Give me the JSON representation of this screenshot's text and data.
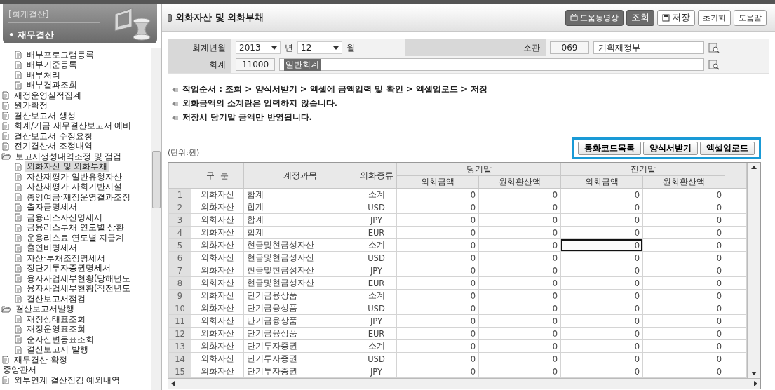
{
  "sidebar": {
    "section": "[회계결산]",
    "title": "• 재무결산",
    "tree": [
      {
        "children": [
          {
            "children": [
              {
                "label": "배부프로그램등록",
                "kind": "doc",
                "selected": false
              },
              {
                "label": "배부기준등록",
                "kind": "doc",
                "selected": false
              },
              {
                "label": "배부처리",
                "kind": "doc",
                "selected": false
              },
              {
                "label": "배부결과조회",
                "kind": "doc",
                "selected": false
              }
            ]
          },
          {
            "label": "재정운영실적집계",
            "kind": "doc",
            "selected": false
          },
          {
            "label": "원가확정",
            "kind": "doc",
            "selected": false
          }
        ]
      },
      {
        "label": "결산보고서 생성",
        "kind": "doc",
        "selected": false
      },
      {
        "label": "회계/기금 재무결산보고서 예비",
        "kind": "doc",
        "selected": false
      },
      {
        "label": "결산보고서 수정요청",
        "kind": "doc",
        "selected": false
      },
      {
        "label": "전기결산서 조정내역",
        "kind": "doc",
        "selected": false
      },
      {
        "label": "보고서생성내역조정 및 점검",
        "kind": "folder",
        "expanded": true,
        "selected": false,
        "children": [
          {
            "label": "외화자산 및 외화부채",
            "kind": "doc",
            "selected": true
          },
          {
            "label": "자산재평가-일반유형자산",
            "kind": "doc",
            "selected": false
          },
          {
            "label": "자산재평가-사회기반시설",
            "kind": "doc",
            "selected": false
          },
          {
            "label": "총잉여금·재정운영결과조정",
            "kind": "doc",
            "selected": false
          },
          {
            "label": "출자금명세서",
            "kind": "doc",
            "selected": false
          },
          {
            "label": "금융리스자산명세서",
            "kind": "doc",
            "selected": false
          },
          {
            "label": "금융리스부채 연도별 상환",
            "kind": "doc",
            "selected": false
          },
          {
            "label": "운용리스료 연도별 지급계",
            "kind": "doc",
            "selected": false
          },
          {
            "label": "출연비명세서",
            "kind": "doc",
            "selected": false
          },
          {
            "label": "자산·부채조정명세서",
            "kind": "doc",
            "selected": false
          },
          {
            "label": "장단기투자증권명세서",
            "kind": "doc",
            "selected": false
          },
          {
            "label": "융자사업세부현황(당해년도",
            "kind": "doc",
            "selected": false
          },
          {
            "label": "융자사업세부현황(직전년도",
            "kind": "doc",
            "selected": false
          },
          {
            "label": "결산보고서점검",
            "kind": "doc",
            "selected": false
          }
        ]
      },
      {
        "label": "결산보고서발행",
        "kind": "folder",
        "expanded": true,
        "selected": false,
        "children": [
          {
            "label": "재정상태표조회",
            "kind": "doc",
            "selected": false
          },
          {
            "label": "재정운영표조회",
            "kind": "doc",
            "selected": false
          },
          {
            "label": "순자산변동표조회",
            "kind": "doc",
            "selected": false
          },
          {
            "label": "결산보고서 발행",
            "kind": "doc",
            "selected": false
          }
        ]
      },
      {
        "label": "재무결산 확정",
        "kind": "doc",
        "selected": false
      },
      {
        "label": "중앙관서",
        "kind": "text",
        "selected": false
      },
      {
        "label": "외부연계 결산점검 예외내역",
        "kind": "doc",
        "selected": false
      }
    ]
  },
  "page": {
    "title": "외화자산 및 외화부채",
    "toolbar": [
      {
        "label": "도움동영상",
        "kind": "video"
      },
      {
        "label": "조회",
        "kind": "primary"
      },
      {
        "label": "저장",
        "kind": "save"
      },
      {
        "label": "초기화",
        "kind": "plain"
      },
      {
        "label": "도움말",
        "kind": "plain"
      }
    ]
  },
  "form": {
    "period_label": "회계년월",
    "year": "2013",
    "year_unit": "년",
    "month": "12",
    "month_unit": "월",
    "ministry_label": "소관",
    "ministry_code": "069",
    "ministry_name": "기획재정부",
    "account_label": "회계",
    "account_code": "11000",
    "account_name": "일반회계",
    "account_name_selected": true
  },
  "notes": [
    "작업순서 : 조회 > 양식서받기 > 엑셀에 금액입력 및 확인 > 엑셀업로드 > 저장",
    "외화금액의 소계란은 입력하지 않습니다.",
    "저장시 당기말 금액만 반영됩니다."
  ],
  "unit": "(단위:원)",
  "actions": [
    "통화코드목록",
    "양식서받기",
    "엑셀업로드"
  ],
  "table": {
    "columns": {
      "category": "구  분",
      "account": "계정과목",
      "currency": "외화종류",
      "groups": [
        {
          "label": "당기말",
          "sub": [
            "외화금액",
            "원화환산액"
          ]
        },
        {
          "label": "전기말",
          "sub": [
            "외화금액",
            "원화환산액"
          ]
        }
      ]
    },
    "rows": [
      {
        "no": "1",
        "category": "외화자산",
        "account": "합계",
        "currency": "소계",
        "amounts": [
          {
            "value": "0",
            "focused": false
          },
          {
            "value": "0",
            "focused": false
          },
          {
            "value": "0",
            "focused": false
          },
          {
            "value": "0",
            "focused": false
          }
        ]
      },
      {
        "no": "2",
        "category": "외화자산",
        "account": "합계",
        "currency": "USD",
        "amounts": [
          {
            "value": "0",
            "focused": false
          },
          {
            "value": "0",
            "focused": false
          },
          {
            "value": "0",
            "focused": false
          },
          {
            "value": "0",
            "focused": false
          }
        ]
      },
      {
        "no": "3",
        "category": "외화자산",
        "account": "합계",
        "currency": "JPY",
        "amounts": [
          {
            "value": "0",
            "focused": false
          },
          {
            "value": "0",
            "focused": false
          },
          {
            "value": "0",
            "focused": false
          },
          {
            "value": "0",
            "focused": false
          }
        ]
      },
      {
        "no": "4",
        "category": "외화자산",
        "account": "합계",
        "currency": "EUR",
        "amounts": [
          {
            "value": "0",
            "focused": false
          },
          {
            "value": "0",
            "focused": false
          },
          {
            "value": "0",
            "focused": false
          },
          {
            "value": "0",
            "focused": false
          }
        ]
      },
      {
        "no": "5",
        "category": "외화자산",
        "account": "현금및현금성자산",
        "currency": "소계",
        "amounts": [
          {
            "value": "0",
            "focused": false
          },
          {
            "value": "0",
            "focused": false
          },
          {
            "value": "0",
            "focused": true
          },
          {
            "value": "0",
            "focused": false
          }
        ]
      },
      {
        "no": "6",
        "category": "외화자산",
        "account": "현금및현금성자산",
        "currency": "USD",
        "amounts": [
          {
            "value": "0",
            "focused": false
          },
          {
            "value": "0",
            "focused": false
          },
          {
            "value": "0",
            "focused": false
          },
          {
            "value": "0",
            "focused": false
          }
        ]
      },
      {
        "no": "7",
        "category": "외화자산",
        "account": "현금및현금성자산",
        "currency": "JPY",
        "amounts": [
          {
            "value": "0",
            "focused": false
          },
          {
            "value": "0",
            "focused": false
          },
          {
            "value": "0",
            "focused": false
          },
          {
            "value": "0",
            "focused": false
          }
        ]
      },
      {
        "no": "8",
        "category": "외화자산",
        "account": "현금및현금성자산",
        "currency": "EUR",
        "amounts": [
          {
            "value": "0",
            "focused": false
          },
          {
            "value": "0",
            "focused": false
          },
          {
            "value": "0",
            "focused": false
          },
          {
            "value": "0",
            "focused": false
          }
        ]
      },
      {
        "no": "9",
        "category": "외화자산",
        "account": "단기금융상품",
        "currency": "소계",
        "amounts": [
          {
            "value": "0",
            "focused": false
          },
          {
            "value": "0",
            "focused": false
          },
          {
            "value": "0",
            "focused": false
          },
          {
            "value": "0",
            "focused": false
          }
        ]
      },
      {
        "no": "10",
        "category": "외화자산",
        "account": "단기금융상품",
        "currency": "USD",
        "amounts": [
          {
            "value": "0",
            "focused": false
          },
          {
            "value": "0",
            "focused": false
          },
          {
            "value": "0",
            "focused": false
          },
          {
            "value": "0",
            "focused": false
          }
        ]
      },
      {
        "no": "11",
        "category": "외화자산",
        "account": "단기금융상품",
        "currency": "JPY",
        "amounts": [
          {
            "value": "0",
            "focused": false
          },
          {
            "value": "0",
            "focused": false
          },
          {
            "value": "0",
            "focused": false
          },
          {
            "value": "0",
            "focused": false
          }
        ]
      },
      {
        "no": "12",
        "category": "외화자산",
        "account": "단기금융상품",
        "currency": "EUR",
        "amounts": [
          {
            "value": "0",
            "focused": false
          },
          {
            "value": "0",
            "focused": false
          },
          {
            "value": "0",
            "focused": false
          },
          {
            "value": "0",
            "focused": false
          }
        ]
      },
      {
        "no": "13",
        "category": "외화자산",
        "account": "단기투자증권",
        "currency": "소계",
        "amounts": [
          {
            "value": "0",
            "focused": false
          },
          {
            "value": "0",
            "focused": false
          },
          {
            "value": "0",
            "focused": false
          },
          {
            "value": "0",
            "focused": false
          }
        ]
      },
      {
        "no": "14",
        "category": "외화자산",
        "account": "단기투자증권",
        "currency": "USD",
        "amounts": [
          {
            "value": "0",
            "focused": false
          },
          {
            "value": "0",
            "focused": false
          },
          {
            "value": "0",
            "focused": false
          },
          {
            "value": "0",
            "focused": false
          }
        ]
      },
      {
        "no": "15",
        "category": "외화자산",
        "account": "단기투자증권",
        "currency": "JPY",
        "amounts": [
          {
            "value": "0",
            "focused": false
          },
          {
            "value": "0",
            "focused": false
          },
          {
            "value": "0",
            "focused": false
          },
          {
            "value": "0",
            "focused": false
          }
        ]
      }
    ]
  }
}
